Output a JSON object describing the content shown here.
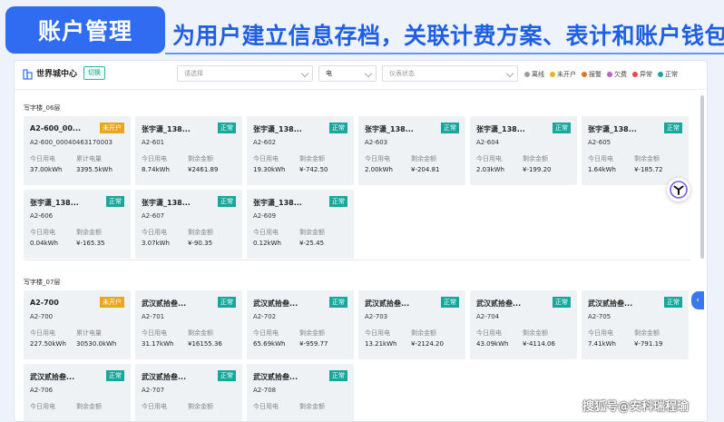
{
  "banner": {
    "tag": "账户管理",
    "text": "为用户建立信息存档，关联计费方案、表计和账户钱包"
  },
  "topbar": {
    "building": "世界城中心",
    "switch_label": "切换",
    "select1_placeholder": "请选择",
    "select2_value": "电",
    "select3_placeholder": "仪表状态"
  },
  "legend": [
    {
      "label": "离线",
      "color": "#9e9e9e"
    },
    {
      "label": "未开户",
      "color": "#e8b61c"
    },
    {
      "label": "报警",
      "color": "#e0761f"
    },
    {
      "label": "欠费",
      "color": "#c25bd6"
    },
    {
      "label": "异常",
      "color": "#e04b4b"
    },
    {
      "label": "正常",
      "color": "#1aa79b"
    }
  ],
  "floors": [
    {
      "label": "写字楼_06层",
      "cards": [
        {
          "name": "A2-600_00...",
          "badge": "未开户",
          "badge_color": "orange",
          "code": "A2-600_00040463170003",
          "lab1": "今日用电",
          "lab2": "累计电量",
          "val1": "37.00kWh",
          "val2": "3395.5kWh"
        },
        {
          "name": "张宇潇_138...",
          "badge": "正常",
          "badge_color": "green",
          "code": "A2-601",
          "lab1": "今日用电",
          "lab2": "剩余金额",
          "val1": "8.74kWh",
          "val2": "¥2461.89"
        },
        {
          "name": "张宇潇_138...",
          "badge": "正常",
          "badge_color": "green",
          "code": "A2-602",
          "lab1": "今日用电",
          "lab2": "剩余金额",
          "val1": "19.30kWh",
          "val2": "¥-742.50"
        },
        {
          "name": "张宇潇_138...",
          "badge": "正常",
          "badge_color": "green",
          "code": "A2-603",
          "lab1": "今日用电",
          "lab2": "剩余金额",
          "val1": "2.00kWh",
          "val2": "¥-204.81"
        },
        {
          "name": "张宇潇_138...",
          "badge": "正常",
          "badge_color": "green",
          "code": "A2-604",
          "lab1": "今日用电",
          "lab2": "剩余金额",
          "val1": "2.03kWh",
          "val2": "¥-199.20"
        },
        {
          "name": "张宇潇_138...",
          "badge": "正常",
          "badge_color": "green",
          "code": "A2-605",
          "lab1": "今日用电",
          "lab2": "剩余金额",
          "val1": "1.64kWh",
          "val2": "¥-185.72"
        },
        {
          "name": "张宇潇_138...",
          "badge": "正常",
          "badge_color": "green",
          "code": "A2-606",
          "lab1": "今日用电",
          "lab2": "剩余金额",
          "val1": "0.04kWh",
          "val2": "¥-165.35"
        },
        {
          "name": "张宇潇_138...",
          "badge": "正常",
          "badge_color": "green",
          "code": "A2-607",
          "lab1": "今日用电",
          "lab2": "剩余金额",
          "val1": "3.07kWh",
          "val2": "¥-90.35"
        },
        {
          "name": "张宇潇_138...",
          "badge": "正常",
          "badge_color": "green",
          "code": "A2-609",
          "lab1": "今日用电",
          "lab2": "剩余金额",
          "val1": "0.12kWh",
          "val2": "¥-25.45"
        }
      ]
    },
    {
      "label": "写字楼_07层",
      "cards": [
        {
          "name": "A2-700",
          "badge": "未开户",
          "badge_color": "orange",
          "code": "A2-700",
          "lab1": "今日用电",
          "lab2": "累计电量",
          "val1": "227.50kWh",
          "val2": "30530.0kWh"
        },
        {
          "name": "武汉贰拾叁...",
          "badge": "正常",
          "badge_color": "green",
          "code": "A2-701",
          "lab1": "今日用电",
          "lab2": "剩余金额",
          "val1": "31.17kWh",
          "val2": "¥16155.36"
        },
        {
          "name": "武汉贰拾叁...",
          "badge": "正常",
          "badge_color": "green",
          "code": "A2-702",
          "lab1": "今日用电",
          "lab2": "剩余金额",
          "val1": "65.69kWh",
          "val2": "¥-959.77"
        },
        {
          "name": "武汉贰拾叁...",
          "badge": "正常",
          "badge_color": "green",
          "code": "A2-703",
          "lab1": "今日用电",
          "lab2": "剩余金额",
          "val1": "13.21kWh",
          "val2": "¥-2124.20"
        },
        {
          "name": "武汉贰拾叁...",
          "badge": "正常",
          "badge_color": "green",
          "code": "A2-704",
          "lab1": "今日用电",
          "lab2": "剩余金额",
          "val1": "43.09kWh",
          "val2": "¥-4114.06"
        },
        {
          "name": "武汉贰拾叁...",
          "badge": "正常",
          "badge_color": "green",
          "code": "A2-705",
          "lab1": "今日用电",
          "lab2": "剩余金额",
          "val1": "7.41kWh",
          "val2": "¥-791.19"
        },
        {
          "name": "武汉贰拾叁...",
          "badge": "正常",
          "badge_color": "green",
          "code": "A2-706",
          "lab1": "今日用电",
          "lab2": "剩余金额",
          "val1": "",
          "val2": ""
        },
        {
          "name": "武汉贰拾叁...",
          "badge": "正常",
          "badge_color": "green",
          "code": "A2-707",
          "lab1": "今日用电",
          "lab2": "剩余金额",
          "val1": "",
          "val2": ""
        },
        {
          "name": "武汉贰拾叁...",
          "badge": "正常",
          "badge_color": "green",
          "code": "A2-708",
          "lab1": "今日用电",
          "lab2": "剩余金额",
          "val1": "",
          "val2": ""
        }
      ]
    }
  ],
  "watermark": "搜狐号@安科瑞程瑜"
}
